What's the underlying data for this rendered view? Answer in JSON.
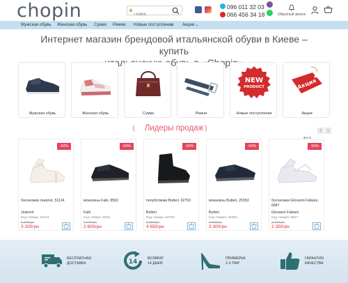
{
  "header": {
    "logo": "chopin",
    "search_placeholder": "Поиск",
    "phone1": "096 011 32 03",
    "phone2": "066 456 34 18",
    "callback": "Обратный звонок",
    "colors": {
      "logo": "#565d6b",
      "accent": "#e05a6a",
      "nav_bg": "#c5dff0",
      "price": "#e0243b"
    }
  },
  "nav": {
    "items": [
      "Мужская обувь",
      "Женская обувь",
      "Сумки",
      "Ремни",
      "Новые поступления",
      "Акции"
    ]
  },
  "hero": {
    "title_line1": "Интернет магазин брендовой итальянской обуви в Киеве – купить",
    "title_line2": "итальянскую обувь в «Chopin»"
  },
  "categories": [
    {
      "label": "Мужская обувь",
      "icon": "men-shoe-image"
    },
    {
      "label": "Женская обувь",
      "icon": "women-sneaker-image"
    },
    {
      "label": "Сумки",
      "icon": "bag-image"
    },
    {
      "label": "Ремни",
      "icon": "belt-image"
    },
    {
      "label": "Новые поступления",
      "icon": "new-product-stamp",
      "stamp_text": "NEW PRODUCT"
    },
    {
      "label": "Акции",
      "icon": "sale-tag",
      "tag_text": "Акция"
    }
  ],
  "leaders": {
    "title": "Лидеры продаж"
  },
  "products": [
    {
      "discount": "-50%",
      "name": "босоножки Jeannot, 51124",
      "brand": "Jeannot",
      "code": "Код товара: 51124",
      "old_price": "6 400грн",
      "price": "3 200грн"
    },
    {
      "discount": "-50%",
      "name": "мокасины Fabi, 8563",
      "brand": "Fabi",
      "code": "Код товара: 8563",
      "old_price": "5 200грн",
      "price": "2 600грн"
    },
    {
      "discount": "-50%",
      "name": "полуботинки Butteri, 62763",
      "brand": "Butteri",
      "code": "Код товара: 62763",
      "old_price": "9 300грн",
      "price": "4 650грн"
    },
    {
      "discount": "-50%",
      "name": "мокасины Butteri, 25353",
      "brand": "Butteri",
      "code": "Код товара: 25353",
      "old_price": "6 600грн",
      "price": "3 300грн"
    },
    {
      "discount": "-50%",
      "name": "босоножки Giovanni Fabiani, 6847",
      "brand": "Giovanni Fabiani",
      "code": "Код товара: 6847",
      "old_price": "4 700грн",
      "price": "2 350грн"
    }
  ],
  "benefits": [
    {
      "line1": "БЕСПЛАТНАЯ",
      "line2": "ДОСТАВКА",
      "icon": "truck-icon"
    },
    {
      "line1": "ВОЗВРАТ",
      "line2": "14 ДНЕЙ",
      "icon": "return-14-icon"
    },
    {
      "line1": "ПРИМЕРКА",
      "line2": "2-Х ПАР",
      "icon": "heel-shoe-icon"
    },
    {
      "line1": "ГАРАНТИЯ",
      "line2": "КАЧЕСТВА",
      "icon": "thumbs-up-icon"
    }
  ]
}
